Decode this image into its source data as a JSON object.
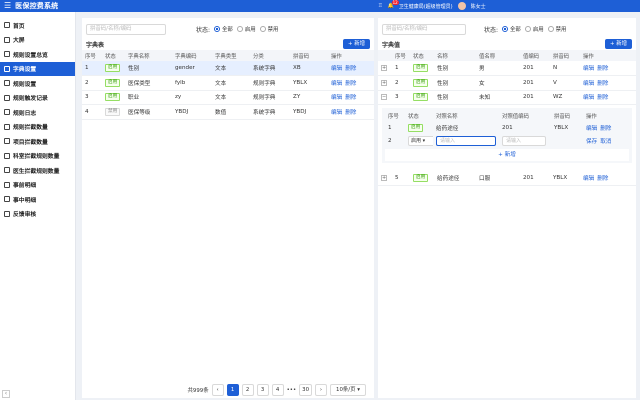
{
  "app": {
    "title": "医保控费系统",
    "user_org": "卫生健康局(超级管理员)",
    "user_name": "陈女士",
    "notif_count": "12"
  },
  "sidebar": {
    "items": [
      {
        "label": "首页"
      },
      {
        "label": "大屏"
      },
      {
        "label": "规则设置总览"
      },
      {
        "label": "字典设置",
        "active": true
      },
      {
        "label": "规则设置"
      },
      {
        "label": "规则触发记录"
      },
      {
        "label": "规则日志"
      },
      {
        "label": "规则拦截数量"
      },
      {
        "label": "项目拦截数量"
      },
      {
        "label": "科室拦截规则数量"
      },
      {
        "label": "医生拦截规则数量"
      },
      {
        "label": "事前明细"
      },
      {
        "label": "事中明细"
      },
      {
        "label": "反馈审核"
      }
    ]
  },
  "left": {
    "search_placeholder": "拼音码/名称/编码",
    "status_label": "状态:",
    "radios": [
      "全部",
      "启用",
      "禁用"
    ],
    "section_title": "字典表",
    "add_label": "+ 新增",
    "columns": [
      "序号",
      "状态",
      "字典名称",
      "字典编码",
      "字典类型",
      "分类",
      "拼音码",
      "操作"
    ],
    "rows": [
      {
        "no": "1",
        "status": "启用",
        "name": "性别",
        "code": "gender",
        "type": "文本",
        "cat": "系统字典",
        "py": "XB"
      },
      {
        "no": "2",
        "status": "启用",
        "name": "医保类型",
        "code": "fylb",
        "type": "文本",
        "cat": "规则字典",
        "py": "YBLX"
      },
      {
        "no": "3",
        "status": "启用",
        "name": "职业",
        "code": "zy",
        "type": "文本",
        "cat": "规则字典",
        "py": "ZY"
      },
      {
        "no": "4",
        "status": "禁用",
        "name": "医保等级",
        "code": "YBDJ",
        "type": "数值",
        "cat": "系统字典",
        "py": "YBDJ"
      }
    ],
    "edit": "编辑",
    "del": "删除"
  },
  "pager": {
    "total": "共999条",
    "pages": [
      "1",
      "2",
      "3",
      "4",
      "•••",
      "30"
    ],
    "size": "10条/页"
  },
  "right": {
    "search_placeholder": "拼音码/名称/编码",
    "status_label": "状态:",
    "radios": [
      "全部",
      "启用",
      "禁用"
    ],
    "section_title": "字典值",
    "add_label": "+ 新增",
    "columns": [
      "",
      "序号",
      "状态",
      "名称",
      "值名称",
      "值编码",
      "拼音码",
      "操作"
    ],
    "rows": [
      {
        "no": "1",
        "status": "启用",
        "name": "性别",
        "val": "男",
        "code": "201",
        "py": "N"
      },
      {
        "no": "2",
        "status": "启用",
        "name": "性别",
        "val": "女",
        "code": "201",
        "py": "V"
      },
      {
        "no": "3",
        "status": "启用",
        "name": "性别",
        "val": "未知",
        "code": "201",
        "py": "WZ"
      }
    ],
    "sub": {
      "columns": [
        "序号",
        "状态",
        "对照名称",
        "对照值编码",
        "拼音码",
        "操作"
      ],
      "row1": {
        "no": "1",
        "status": "启用",
        "name": "给药途径",
        "code": "201",
        "py": "YBLX"
      },
      "row2": {
        "no": "2",
        "status": "启用",
        "ph": "请输入",
        "save": "保存",
        "cancel": "取消"
      },
      "add": "+ 新增"
    },
    "row5": {
      "no": "5",
      "status": "启用",
      "name": "给药途径",
      "val": "口服",
      "code": "201",
      "py": "YBLX"
    },
    "edit": "编辑",
    "del": "删除"
  }
}
